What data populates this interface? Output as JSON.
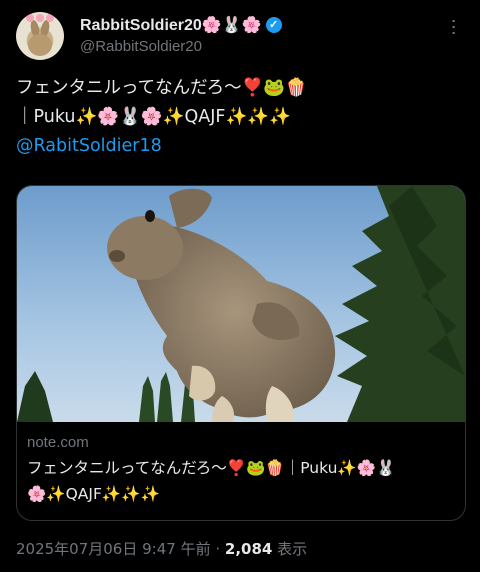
{
  "author": {
    "display_name": "RabbitSoldier20🌸🐰🌸",
    "handle": "@RabbitSoldier20",
    "verified_icon": "verified-badge-icon",
    "more_icon": "more-options-icon"
  },
  "tweet": {
    "line1": "フェンタニルってなんだろ〜❣️🐸🍿",
    "line2": "｜Puku✨🌸🐰🌸✨QAJF✨✨✨",
    "mention": "@RabitSoldier18"
  },
  "card": {
    "image_icon": "rabbit-jumping-photo",
    "domain": "note.com",
    "title_line1": "フェンタニルってなんだろ〜❣️🐸🍿｜Puku✨🌸🐰",
    "title_line2": "🌸✨QAJF✨✨✨"
  },
  "meta": {
    "timestamp": "2025年07月06日 9:47 午前",
    "separator": " · ",
    "views_count": "2,084",
    "views_label": " 表示"
  },
  "colors": {
    "background": "#000000",
    "text": "#e7e9ea",
    "secondary": "#71767b",
    "link": "#1d9bf0",
    "border": "#2f3336"
  }
}
